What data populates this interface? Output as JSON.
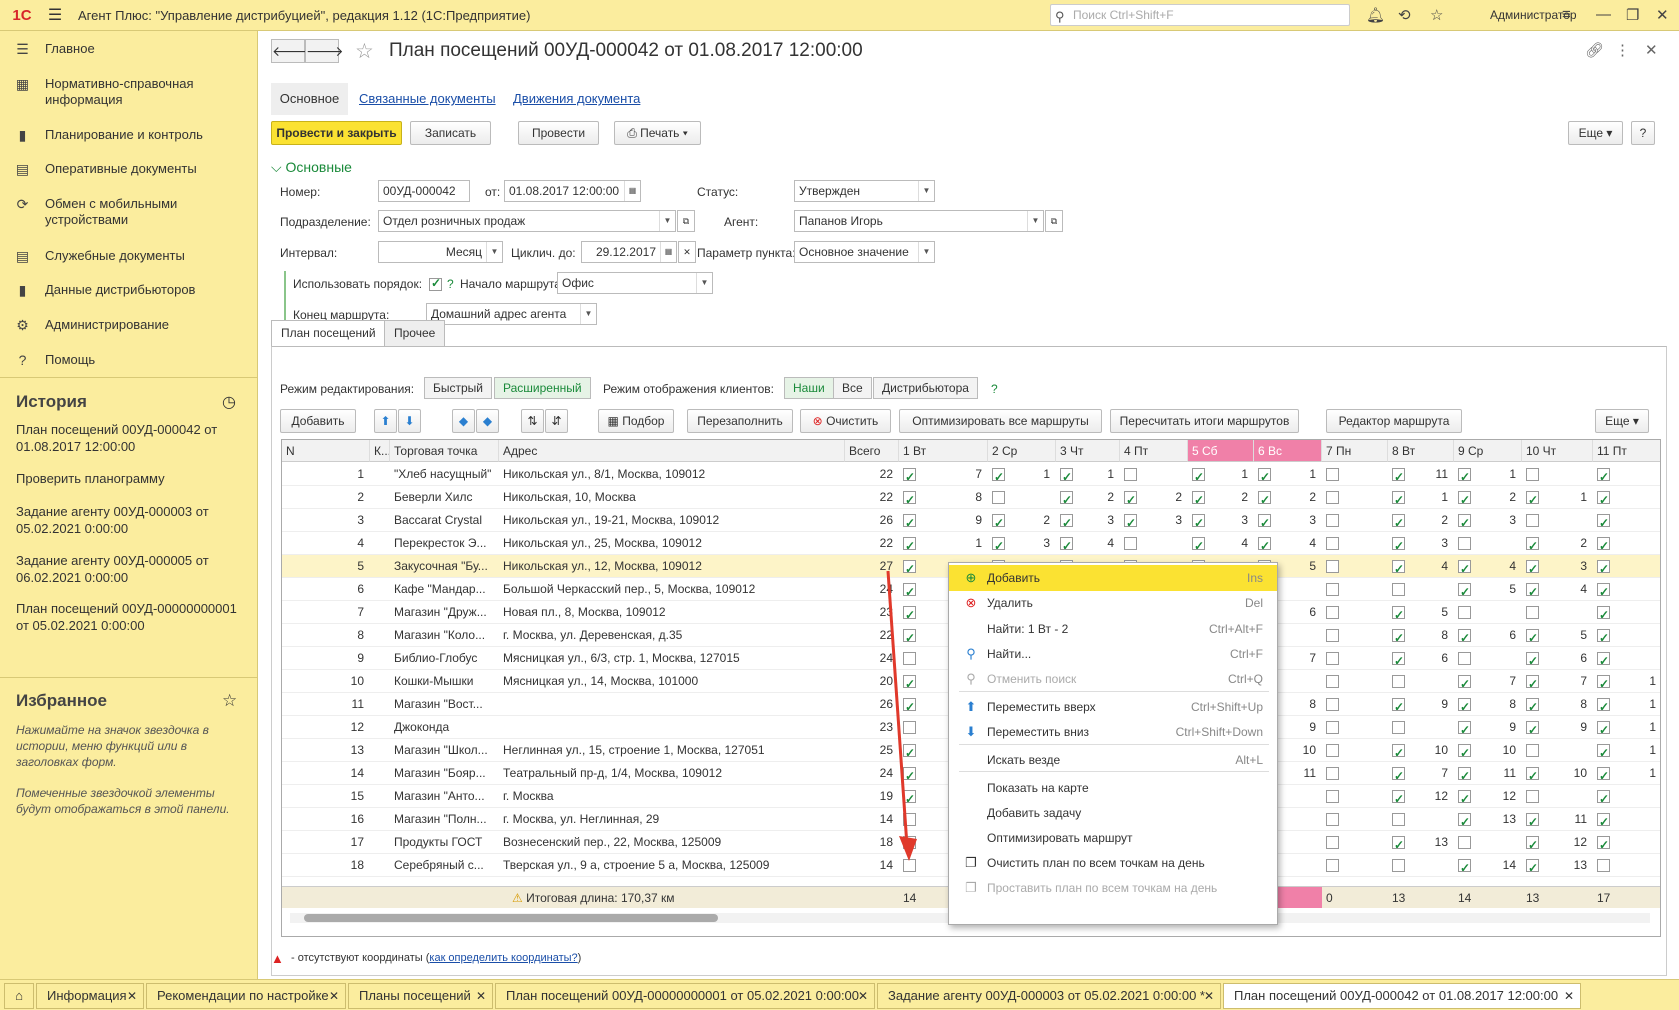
{
  "app": {
    "logo": "1С",
    "title": "Агент Плюс: \"Управление дистрибуцией\", редакция 1.12  (1С:Предприятие)",
    "search_placeholder": "Поиск Ctrl+Shift+F",
    "user": "Администратор"
  },
  "sidebar": {
    "items": [
      {
        "label": "Главное",
        "icon": "hamburger-icon"
      },
      {
        "label": "Нормативно-справочная информация",
        "icon": "grid-icon"
      },
      {
        "label": "Планирование и контроль",
        "icon": "bar-chart-icon"
      },
      {
        "label": "Оперативные документы",
        "icon": "documents-icon"
      },
      {
        "label": "Обмен с мобильными устройствами",
        "icon": "sync-icon"
      },
      {
        "label": "Служебные документы",
        "icon": "documents-icon"
      },
      {
        "label": "Данные дистрибьюторов",
        "icon": "bar-chart-icon"
      },
      {
        "label": "Администрирование",
        "icon": "gear-icon"
      },
      {
        "label": "Помощь",
        "icon": "question-icon"
      }
    ],
    "history_title": "История",
    "history": [
      "План посещений 00УД-000042 от 01.08.2017 12:00:00",
      "Проверить планограмму",
      "Задание агенту 00УД-000003 от 05.02.2021 0:00:00",
      "Задание агенту 00УД-000005 от 06.02.2021 0:00:00",
      "План посещений 00УД-00000000001 от 05.02.2021 0:00:00"
    ],
    "fav_title": "Избранное",
    "fav_text1": "Нажимайте на значок звездочка в истории, меню функций или в заголовках форм.",
    "fav_text2": "Помеченные звездочкой элементы будут отображаться в этой панели."
  },
  "doc": {
    "title": "План посещений 00УД-000042 от 01.08.2017 12:00:00",
    "tabs": [
      "Основное",
      "Связанные документы",
      "Движения документа"
    ],
    "buttons": {
      "post_close": "Провести и закрыть",
      "save": "Записать",
      "post": "Провести",
      "print": "Печать",
      "more": "Еще",
      "help": "?"
    },
    "group_title": "Основные",
    "fields": {
      "number_label": "Номер:",
      "number": "00УД-000042",
      "from_label": "от:",
      "from": "01.08.2017 12:00:00",
      "status_label": "Статус:",
      "status": "Утвержден",
      "dept_label": "Подразделение:",
      "dept": "Отдел розничных продаж",
      "agent_label": "Агент:",
      "agent": "Папанов Игорь",
      "interval_label": "Интервал:",
      "interval": "Месяц",
      "cycle_label": "Циклич. до:",
      "cycle": "29.12.2017",
      "param_label": "Параметр пункта:",
      "param": "Основное значение",
      "order_label": "Использовать порядок:",
      "order_help": "?",
      "start_label": "Начало маршрута:",
      "start": "Офис",
      "end_label": "Конец маршрута:",
      "end": "Домашний адрес агента"
    },
    "subtabs": [
      "План посещений",
      "Прочее"
    ],
    "edit_mode_label": "Режим редактирования:",
    "edit_modes": [
      "Быстрый",
      "Расширенный"
    ],
    "display_mode_label": "Режим отображения клиентов:",
    "display_modes": [
      "Наши",
      "Все",
      "Дистрибьютора"
    ],
    "display_help": "?",
    "toolbar": {
      "add": "Добавить",
      "pick": "Подбор",
      "refill": "Перезаполнить",
      "clear": "Очистить",
      "optimize_all": "Оптимизировать все маршруты",
      "recalc": "Пересчитать итоги маршрутов",
      "editor": "Редактор маршрута",
      "more": "Еще"
    }
  },
  "grid": {
    "columns": [
      "N",
      "К...",
      "Торговая точка",
      "Адрес",
      "Всего",
      "1 Вт",
      "2 Ср",
      "3 Чт",
      "4 Пт",
      "5 Сб",
      "6 Вс",
      "7 Пн",
      "8 Вт",
      "9 Ср",
      "10 Чт",
      "11 Пт"
    ],
    "rows": [
      {
        "n": "1",
        "point": "\"Хлеб насущный\"",
        "addr": "Никольская ул., 8/1, Москва, 109012",
        "total": "22",
        "d": [
          [
            1,
            "7"
          ],
          [
            1,
            "1"
          ],
          [
            1,
            "1"
          ],
          [
            0,
            ""
          ],
          [
            1,
            "1"
          ],
          [
            1,
            "1"
          ],
          [
            0,
            ""
          ],
          [
            1,
            "11"
          ],
          [
            1,
            "1"
          ],
          [
            0,
            ""
          ],
          [
            1,
            ""
          ]
        ]
      },
      {
        "n": "2",
        "point": "Беверли Хилс",
        "addr": "Никольская, 10, Москва",
        "total": "22",
        "d": [
          [
            1,
            "8"
          ],
          [
            0,
            ""
          ],
          [
            1,
            "2"
          ],
          [
            1,
            "2"
          ],
          [
            1,
            "2"
          ],
          [
            1,
            "2"
          ],
          [
            0,
            ""
          ],
          [
            1,
            "1"
          ],
          [
            1,
            "2"
          ],
          [
            1,
            "1"
          ],
          [
            1,
            ""
          ]
        ]
      },
      {
        "n": "3",
        "point": "Baccarat Crystal",
        "addr": "Никольская ул., 19-21, Москва, 109012",
        "total": "26",
        "d": [
          [
            1,
            "9"
          ],
          [
            1,
            "2"
          ],
          [
            1,
            "3"
          ],
          [
            1,
            "3"
          ],
          [
            1,
            "3"
          ],
          [
            1,
            "3"
          ],
          [
            0,
            ""
          ],
          [
            1,
            "2"
          ],
          [
            1,
            "3"
          ],
          [
            0,
            ""
          ],
          [
            1,
            ""
          ]
        ]
      },
      {
        "n": "4",
        "point": "Перекресток Э...",
        "addr": "Никольская ул., 25, Москва, 109012",
        "total": "22",
        "d": [
          [
            1,
            "1"
          ],
          [
            1,
            "3"
          ],
          [
            1,
            "4"
          ],
          [
            0,
            ""
          ],
          [
            1,
            "4"
          ],
          [
            1,
            "4"
          ],
          [
            0,
            ""
          ],
          [
            1,
            "3"
          ],
          [
            0,
            ""
          ],
          [
            1,
            "2"
          ],
          [
            1,
            ""
          ]
        ]
      },
      {
        "n": "5",
        "point": "Закусочная \"Бу...",
        "addr": "Никольская ул., 12, Москва, 109012",
        "total": "27",
        "d": [
          [
            1,
            ""
          ],
          [
            0,
            ""
          ],
          [
            0,
            ""
          ],
          [
            0,
            ""
          ],
          [
            0,
            ""
          ],
          [
            0,
            "5"
          ],
          [
            0,
            ""
          ],
          [
            1,
            "4"
          ],
          [
            1,
            "4"
          ],
          [
            1,
            "3"
          ],
          [
            1,
            ""
          ]
        ]
      },
      {
        "n": "6",
        "point": "Кафе \"Мандар...",
        "addr": "Большой Черкасский пер., 5, Москва, 109012",
        "total": "24",
        "d": [
          [
            1,
            ""
          ],
          [
            0,
            ""
          ],
          [
            0,
            ""
          ],
          [
            0,
            ""
          ],
          [
            0,
            ""
          ],
          [
            0,
            ""
          ],
          [
            0,
            ""
          ],
          [
            0,
            ""
          ],
          [
            1,
            "5"
          ],
          [
            1,
            "4"
          ],
          [
            1,
            ""
          ]
        ]
      },
      {
        "n": "7",
        "point": "Магазин \"Друж...",
        "addr": "Новая пл., 8, Москва, 109012",
        "total": "23",
        "d": [
          [
            1,
            ""
          ],
          [
            0,
            ""
          ],
          [
            0,
            ""
          ],
          [
            0,
            ""
          ],
          [
            0,
            ""
          ],
          [
            0,
            "6"
          ],
          [
            0,
            ""
          ],
          [
            1,
            "5"
          ],
          [
            0,
            ""
          ],
          [
            0,
            ""
          ],
          [
            1,
            ""
          ]
        ]
      },
      {
        "n": "8",
        "point": "Магазин \"Коло...",
        "addr": "г. Москва, ул. Деревенская, д.35",
        "total": "22",
        "d": [
          [
            1,
            ""
          ],
          [
            0,
            ""
          ],
          [
            0,
            ""
          ],
          [
            0,
            ""
          ],
          [
            0,
            ""
          ],
          [
            0,
            ""
          ],
          [
            0,
            ""
          ],
          [
            1,
            "8"
          ],
          [
            1,
            "6"
          ],
          [
            1,
            "5"
          ],
          [
            1,
            ""
          ]
        ]
      },
      {
        "n": "9",
        "point": "Библио-Глобус",
        "addr": "Мясницкая ул., 6/3, стр. 1, Москва, 127015",
        "total": "24",
        "d": [
          [
            0,
            ""
          ],
          [
            0,
            ""
          ],
          [
            0,
            ""
          ],
          [
            0,
            ""
          ],
          [
            0,
            ""
          ],
          [
            0,
            "7"
          ],
          [
            0,
            ""
          ],
          [
            1,
            "6"
          ],
          [
            0,
            ""
          ],
          [
            1,
            "6"
          ],
          [
            1,
            ""
          ]
        ]
      },
      {
        "n": "10",
        "point": "Кошки-Мышки",
        "addr": "Мясницкая ул., 14, Москва, 101000",
        "total": "20",
        "d": [
          [
            1,
            ""
          ],
          [
            0,
            ""
          ],
          [
            0,
            ""
          ],
          [
            0,
            ""
          ],
          [
            0,
            ""
          ],
          [
            0,
            ""
          ],
          [
            0,
            ""
          ],
          [
            0,
            ""
          ],
          [
            1,
            "7"
          ],
          [
            1,
            "7"
          ],
          [
            1,
            "1"
          ]
        ]
      },
      {
        "n": "11",
        "point": "Магазин \"Вост...",
        "addr": "",
        "total": "26",
        "d": [
          [
            1,
            ""
          ],
          [
            0,
            ""
          ],
          [
            0,
            ""
          ],
          [
            0,
            ""
          ],
          [
            0,
            ""
          ],
          [
            0,
            "8"
          ],
          [
            0,
            ""
          ],
          [
            1,
            "9"
          ],
          [
            1,
            "8"
          ],
          [
            1,
            "8"
          ],
          [
            1,
            "1"
          ]
        ]
      },
      {
        "n": "12",
        "point": "Джоконда",
        "addr": "",
        "total": "23",
        "d": [
          [
            0,
            ""
          ],
          [
            0,
            ""
          ],
          [
            0,
            ""
          ],
          [
            0,
            ""
          ],
          [
            0,
            ""
          ],
          [
            0,
            "9"
          ],
          [
            0,
            ""
          ],
          [
            0,
            ""
          ],
          [
            1,
            "9"
          ],
          [
            1,
            "9"
          ],
          [
            1,
            "1"
          ]
        ]
      },
      {
        "n": "13",
        "point": "Магазин \"Школ...",
        "addr": "Неглинная ул., 15, строение 1, Москва, 127051",
        "total": "25",
        "d": [
          [
            1,
            ""
          ],
          [
            0,
            ""
          ],
          [
            0,
            ""
          ],
          [
            0,
            ""
          ],
          [
            0,
            ""
          ],
          [
            0,
            "10"
          ],
          [
            0,
            ""
          ],
          [
            1,
            "10"
          ],
          [
            1,
            "10"
          ],
          [
            0,
            ""
          ],
          [
            1,
            "1"
          ]
        ]
      },
      {
        "n": "14",
        "point": "Магазин \"Бояр...",
        "addr": "Театральный пр-д, 1/4, Москва, 109012",
        "total": "24",
        "d": [
          [
            1,
            ""
          ],
          [
            0,
            ""
          ],
          [
            0,
            ""
          ],
          [
            0,
            ""
          ],
          [
            0,
            ""
          ],
          [
            0,
            "11"
          ],
          [
            0,
            ""
          ],
          [
            1,
            "7"
          ],
          [
            1,
            "11"
          ],
          [
            1,
            "10"
          ],
          [
            1,
            "1"
          ]
        ]
      },
      {
        "n": "15",
        "point": "Магазин \"Анто...",
        "addr": "г. Москва",
        "total": "19",
        "d": [
          [
            1,
            ""
          ],
          [
            0,
            ""
          ],
          [
            0,
            ""
          ],
          [
            0,
            ""
          ],
          [
            0,
            ""
          ],
          [
            0,
            ""
          ],
          [
            0,
            ""
          ],
          [
            1,
            "12"
          ],
          [
            1,
            "12"
          ],
          [
            0,
            ""
          ],
          [
            1,
            ""
          ]
        ]
      },
      {
        "n": "16",
        "point": "Магазин \"Полн...",
        "addr": "г. Москва, ул. Неглинная, 29",
        "total": "14",
        "d": [
          [
            0,
            ""
          ],
          [
            0,
            ""
          ],
          [
            0,
            ""
          ],
          [
            0,
            ""
          ],
          [
            0,
            ""
          ],
          [
            0,
            ""
          ],
          [
            0,
            ""
          ],
          [
            0,
            ""
          ],
          [
            1,
            "13"
          ],
          [
            1,
            "11"
          ],
          [
            1,
            ""
          ]
        ]
      },
      {
        "n": "17",
        "point": "Продукты ГОСТ",
        "addr": "Вознесенский пер., 22, Москва, 125009",
        "total": "18",
        "d": [
          [
            1,
            ""
          ],
          [
            0,
            ""
          ],
          [
            0,
            ""
          ],
          [
            0,
            ""
          ],
          [
            0,
            ""
          ],
          [
            0,
            ""
          ],
          [
            0,
            ""
          ],
          [
            1,
            "13"
          ],
          [
            0,
            ""
          ],
          [
            1,
            "12"
          ],
          [
            1,
            ""
          ]
        ]
      },
      {
        "n": "18",
        "point": "Серебряный с...",
        "addr": "Тверская ул., 9 а, строение 5 а, Москва, 125009",
        "total": "14",
        "d": [
          [
            0,
            ""
          ],
          [
            0,
            ""
          ],
          [
            0,
            ""
          ],
          [
            0,
            ""
          ],
          [
            0,
            ""
          ],
          [
            0,
            ""
          ],
          [
            0,
            ""
          ],
          [
            0,
            ""
          ],
          [
            1,
            "14"
          ],
          [
            1,
            "13"
          ],
          [
            0,
            ""
          ]
        ]
      }
    ],
    "footer": {
      "length": "Итоговая длина: 170,37 км",
      "totals": [
        "14",
        "",
        "",
        "",
        "",
        "",
        "0",
        "13",
        "14",
        "13",
        "17"
      ]
    }
  },
  "context_menu": [
    {
      "label": "Добавить",
      "shortcut": "Ins",
      "icon": "plus-circle-icon",
      "hl": true
    },
    {
      "label": "Удалить",
      "shortcut": "Del",
      "icon": "delete-icon"
    },
    {
      "label": "Найти: 1 Вт - 2",
      "shortcut": "Ctrl+Alt+F",
      "icon": ""
    },
    {
      "label": "Найти...",
      "shortcut": "Ctrl+F",
      "icon": "search-icon"
    },
    {
      "label": "Отменить поиск",
      "shortcut": "Ctrl+Q",
      "icon": "search-cancel-icon",
      "dis": true
    },
    {
      "label": "Переместить вверх",
      "shortcut": "Ctrl+Shift+Up",
      "icon": "arrow-up-icon"
    },
    {
      "label": "Переместить вниз",
      "shortcut": "Ctrl+Shift+Down",
      "icon": "arrow-down-icon"
    },
    {
      "label": "Искать везде",
      "shortcut": "Alt+L",
      "icon": ""
    },
    {
      "label": "Показать на карте",
      "shortcut": "",
      "icon": ""
    },
    {
      "label": "Добавить задачу",
      "shortcut": "",
      "icon": ""
    },
    {
      "label": "Оптимизировать маршрут",
      "shortcut": "",
      "icon": ""
    },
    {
      "label": "Очистить план по всем точкам на день",
      "shortcut": "",
      "icon": "copy-icon"
    },
    {
      "label": "Проставить план по всем точкам на день",
      "shortcut": "",
      "icon": "stamp-icon",
      "dis": true
    }
  ],
  "legend": {
    "text": "- отсутствуют координаты (",
    "link": "как определить координаты?",
    "close": ")"
  },
  "bottom_tabs": [
    "Информация",
    "Рекомендации по настройке",
    "Планы посещений",
    "План посещений 00УД-00000000001 от 05.02.2021 0:00:00",
    "Задание агенту 00УД-000003 от 05.02.2021 0:00:00 *",
    "План посещений 00УД-000042 от 01.08.2017 12:00:00"
  ],
  "colors": {
    "accent_yellow": "#fbe232",
    "panel": "#fbed9e",
    "pink": "#f080a8",
    "green": "#1a8a3a"
  }
}
